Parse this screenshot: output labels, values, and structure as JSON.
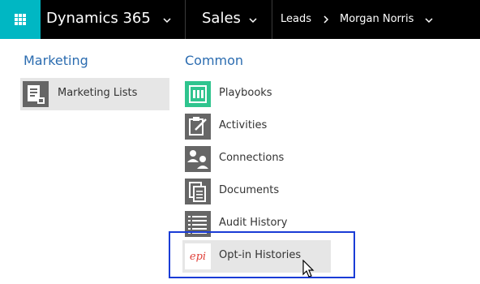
{
  "colors": {
    "topbar_bg": "#000000",
    "waffle_bg": "#00b7c3",
    "group_title": "#2b6cb0",
    "highlight_border": "#1a3cd6",
    "selected_bg": "#e6e6e6"
  },
  "header": {
    "app_name": "Dynamics 365",
    "area": "Sales",
    "entity": "Leads",
    "record": "Morgan Norris"
  },
  "groups": {
    "marketing": {
      "title": "Marketing",
      "items": [
        {
          "label": "Marketing Lists",
          "icon": "marketing-list-icon"
        }
      ]
    },
    "common": {
      "title": "Common",
      "items": [
        {
          "label": "Playbooks",
          "icon": "playbook-icon"
        },
        {
          "label": "Activities",
          "icon": "activities-icon"
        },
        {
          "label": "Connections",
          "icon": "connections-icon"
        },
        {
          "label": "Documents",
          "icon": "documents-icon"
        },
        {
          "label": "Audit History",
          "icon": "audit-history-icon"
        },
        {
          "label": "Opt-in Histories",
          "icon": "opt-in-logo-icon",
          "logo_text": "epi"
        }
      ]
    }
  }
}
